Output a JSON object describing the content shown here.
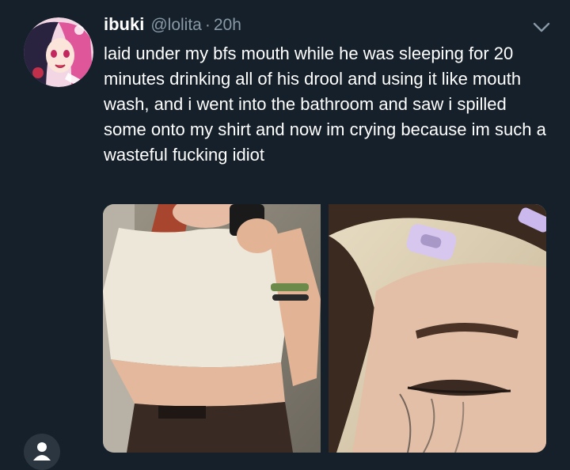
{
  "tweet": {
    "display_name": "ibuki",
    "handle": "@lolita",
    "separator": "·",
    "timestamp": "20h",
    "text": "laid under my bfs mouth while he was sleeping for 20 minutes drinking all of his drool and using it like mouth wash, and i went into the bathroom and saw i spilled some onto my shirt and now im crying because im such a wasteful fucking idiot"
  },
  "icons": {
    "menu": "chevron-down-icon",
    "profile": "person-icon"
  },
  "colors": {
    "background": "#15202b",
    "secondary_text": "#8899a6"
  }
}
